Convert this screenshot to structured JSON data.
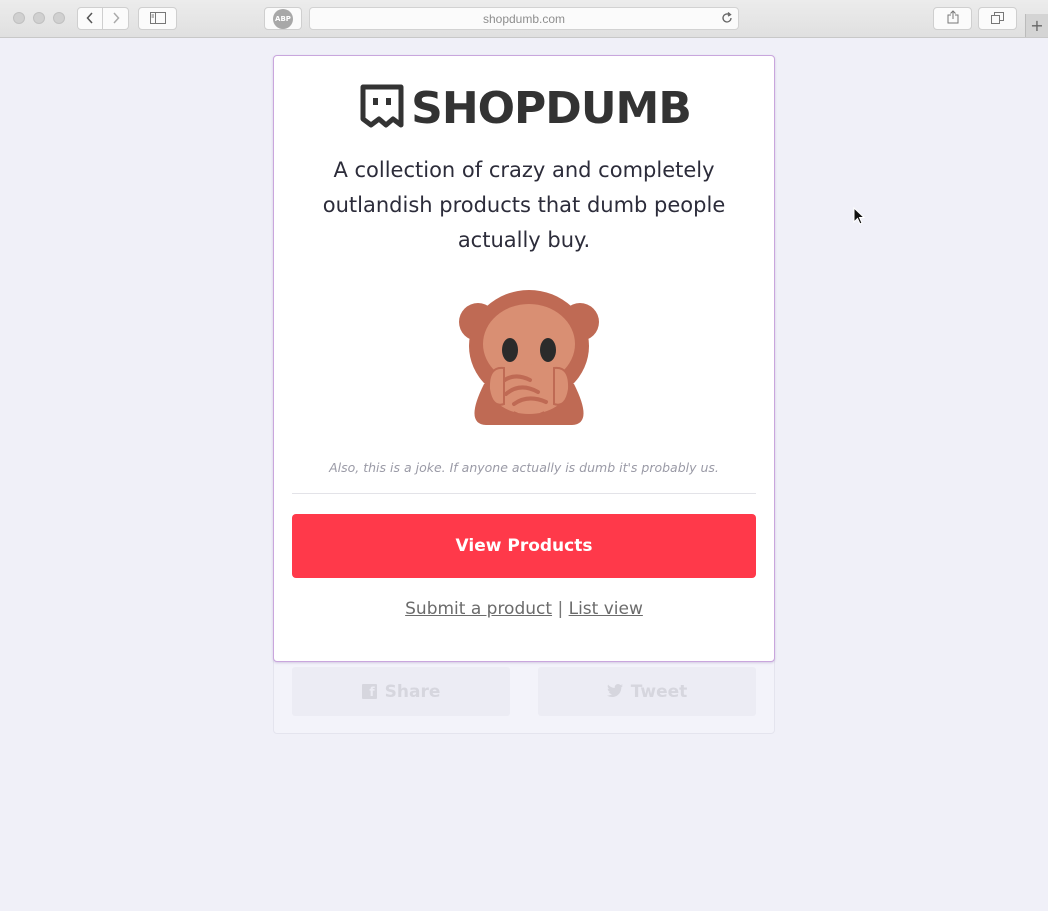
{
  "browser": {
    "url": "shopdumb.com",
    "adblock_label": "ABP"
  },
  "logo": {
    "text": "SHOPDUMB"
  },
  "card": {
    "tagline": "A collection of crazy and completely outlandish products that dumb people actually buy.",
    "joke": "Also, this is a joke. If anyone actually is dumb it's probably us.",
    "view_button": "View Products",
    "link_submit": "Submit a product",
    "link_separator": "|",
    "link_list": "List view"
  },
  "social": {
    "share_label": "Share",
    "tweet_label": "Tweet"
  },
  "colors": {
    "accent": "#ff394a",
    "page_bg": "#f0f0f8",
    "card_border": "#c9a6dd"
  }
}
